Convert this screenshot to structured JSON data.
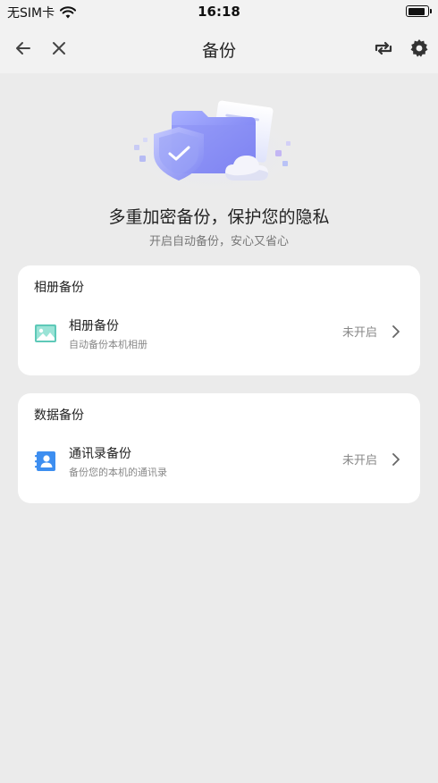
{
  "status_bar": {
    "carrier": "无SIM卡",
    "time": "16:18"
  },
  "nav": {
    "title": "备份",
    "icons": [
      "back-arrow-icon",
      "close-icon",
      "sync-icon",
      "gear-icon"
    ]
  },
  "hero": {
    "title": "多重加密备份，保护您的隐私",
    "subtitle": "开启自动备份，安心又省心"
  },
  "sections": [
    {
      "header": "相册备份",
      "item": {
        "title": "相册备份",
        "subtitle": "自动备份本机相册",
        "status": "未开启",
        "icon": "image-icon"
      }
    },
    {
      "header": "数据备份",
      "item": {
        "title": "通讯录备份",
        "subtitle": "备份您的本机的通讯录",
        "status": "未开启",
        "icon": "contacts-icon"
      }
    }
  ],
  "colors": {
    "background": "#ebebeb",
    "card": "#ffffff",
    "image_icon": "#5ec9b8",
    "contacts_icon": "#3d8ef0",
    "hero_purple": "#7b7ff0"
  }
}
